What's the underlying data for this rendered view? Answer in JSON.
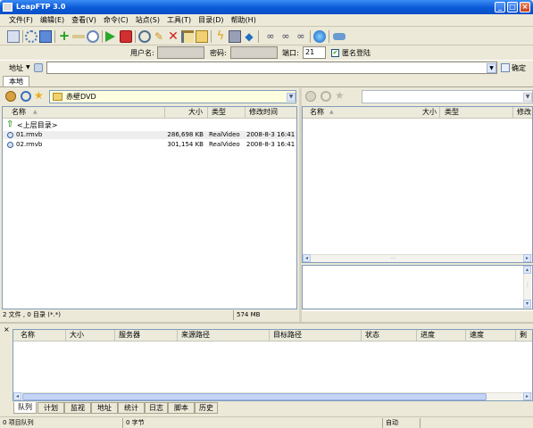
{
  "window": {
    "title": "LeapFTP 3.0"
  },
  "menu": [
    "文件(F)",
    "编辑(E)",
    "查看(V)",
    "命令(C)",
    "站点(S)",
    "工具(T)",
    "目录(D)",
    "帮助(H)"
  ],
  "login": {
    "user_label": "用户名:",
    "pass_label": "密码:",
    "port_label": "端口:",
    "port_value": "21",
    "anon_label": "匿名登陆"
  },
  "address": {
    "label": "地址",
    "value": "",
    "confirm": "确定"
  },
  "local": {
    "tab": "本地",
    "path": "赤壁DVD",
    "columns": [
      "名称",
      "大小",
      "类型",
      "修改时间"
    ],
    "up_label": "<上层目录>",
    "files": [
      {
        "name": "01.rmvb",
        "size": "286,698 KB",
        "type": "RealVideo",
        "modified": "2008-8-3 16:41"
      },
      {
        "name": "02.rmvb",
        "size": "301,154 KB",
        "type": "RealVideo",
        "modified": "2008-8-3 16:41"
      }
    ],
    "status_files": "2 文件 , 0 目录 (*.*)",
    "status_size": "574 MB"
  },
  "remote": {
    "columns": [
      "名称",
      "大小",
      "类型",
      "修改"
    ]
  },
  "queue": {
    "columns": [
      "名称",
      "大小",
      "服务器",
      "来源路径",
      "目标路径",
      "状态",
      "进度",
      "速度",
      "剩"
    ],
    "tabs": [
      "队列",
      "计划",
      "监视",
      "地址",
      "统计",
      "日志",
      "脚本",
      "历史"
    ]
  },
  "statusbar": {
    "queue": "0 项目队列",
    "bytes": "0 字节",
    "mode": "自动"
  },
  "colors": {
    "title_blue": "#0a5ad8",
    "face": "#ece9d8",
    "border": "#7f9db9"
  }
}
